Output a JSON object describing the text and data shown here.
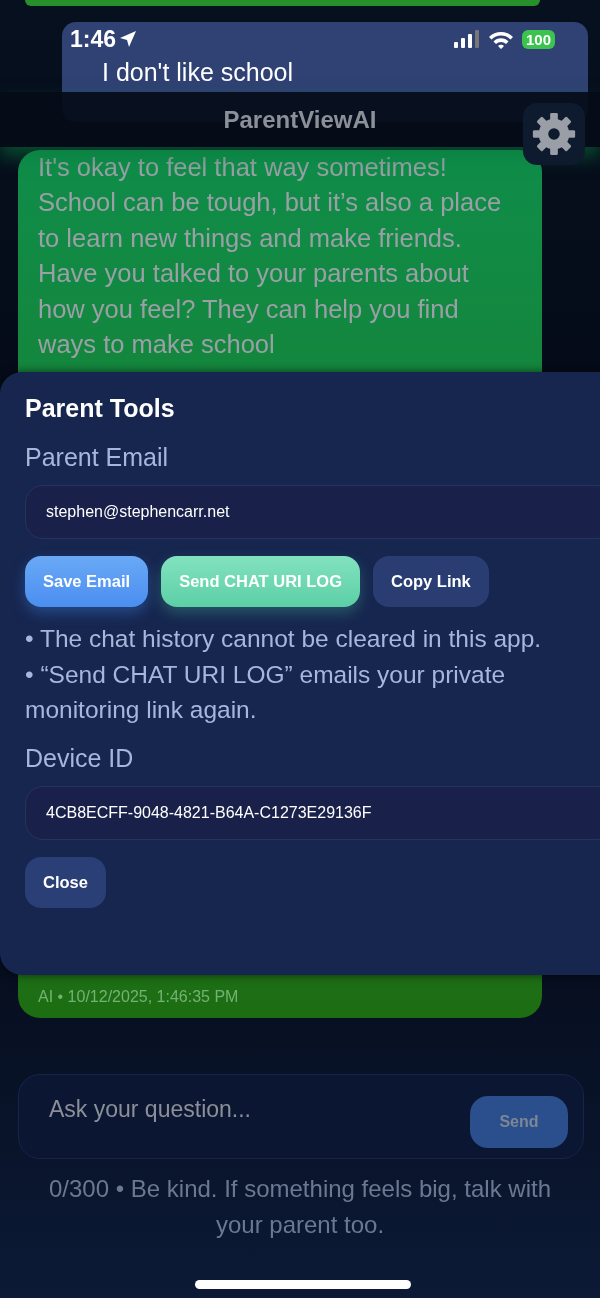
{
  "status_bar": {
    "time": "1:46",
    "battery": "100"
  },
  "header": {
    "title": "ParentViewAI"
  },
  "messages": [
    {
      "kind": "ai"
    },
    {
      "kind": "user",
      "text": "I don't like school"
    },
    {
      "kind": "ai",
      "text": "It's okay to feel that way sometimes! School can be tough, but it’s also a place to learn new things and make friends. Have you talked to your parents about how you feel? They can help you find ways to make school",
      "meta": "AI • 10/12/2025, 1:46:35 PM"
    }
  ],
  "composer": {
    "placeholder": "Ask your question...",
    "send_button": {
      "label": "Send",
      "disabled": true
    }
  },
  "footer_note": "0/300 • Be kind. If something feels big, talk with your parent too.",
  "parent_tools": {
    "title": "Parent Tools",
    "email_label": "Parent Email",
    "email_value": "stephen@stephencarr.net",
    "buttons": [
      {
        "label": "Save Email",
        "kind": "primary"
      },
      {
        "label": "Send CHAT URI LOG",
        "kind": "accent"
      },
      {
        "label": "Copy Link",
        "kind": "secondary"
      }
    ],
    "notes": [
      "• The chat history cannot be cleared in this app.",
      "• “Send CHAT URI LOG” emails your private monitoring link again."
    ],
    "device_label": "Device ID",
    "device_value": "4CB8ECFF-9048-4821-B64A-C1273E29136F",
    "close_button": "Close"
  }
}
